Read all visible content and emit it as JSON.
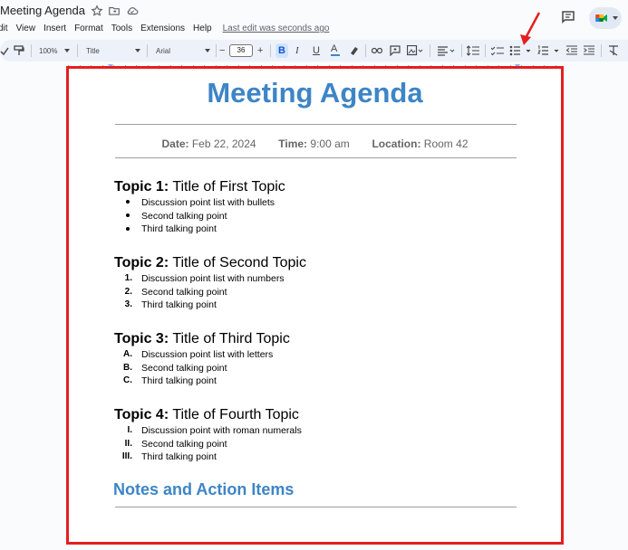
{
  "app": {
    "title": "Meeting Agenda",
    "menu": [
      "dit",
      "View",
      "Insert",
      "Format",
      "Tools",
      "Extensions",
      "Help"
    ],
    "last_edit": "Last edit was seconds ago"
  },
  "toolbar": {
    "zoom": "100%",
    "style": "Title",
    "font": "Arial",
    "font_size": "36",
    "bold_label": "B",
    "italic_label": "I",
    "underline_label": "U",
    "text_color_label": "A",
    "minus_label": "−",
    "plus_label": "+"
  },
  "document": {
    "heading": "Meeting Agenda",
    "meta": {
      "date_label": "Date:",
      "date_value": "Feb 22, 2024",
      "time_label": "Time:",
      "time_value": "9:00 am",
      "location_label": "Location:",
      "location_value": "Room 42"
    },
    "topics": [
      {
        "label": "Topic 1:",
        "title": "Title of First Topic",
        "points": [
          {
            "marker": "•",
            "text": "Discussion point list with bullets"
          },
          {
            "marker": "•",
            "text": "Second talking point"
          },
          {
            "marker": "•",
            "text": "Third talking point"
          }
        ]
      },
      {
        "label": "Topic 2:",
        "title": "Title of Second Topic",
        "points": [
          {
            "marker": "1.",
            "text": "Discussion point list with numbers"
          },
          {
            "marker": "2.",
            "text": "Second talking point"
          },
          {
            "marker": "3.",
            "text": "Third talking point"
          }
        ]
      },
      {
        "label": "Topic 3:",
        "title": "Title of Third Topic",
        "points": [
          {
            "marker": "A.",
            "text": "Discussion point list with letters"
          },
          {
            "marker": "B.",
            "text": "Second talking point"
          },
          {
            "marker": "C.",
            "text": "Third talking point"
          }
        ]
      },
      {
        "label": "Topic 4:",
        "title": "Title of Fourth Topic",
        "points": [
          {
            "marker": "I.",
            "text": "Discussion point with roman numerals"
          },
          {
            "marker": "II.",
            "text": "Second talking point"
          },
          {
            "marker": "III.",
            "text": "Third talking point"
          }
        ]
      }
    ],
    "notes_heading": "Notes and Action Items"
  },
  "colors": {
    "accent": "#3d85c6",
    "highlight_border": "#e31f1f",
    "toolbar_bg": "#edf2fa",
    "bold_active": "#d3e3fd"
  }
}
